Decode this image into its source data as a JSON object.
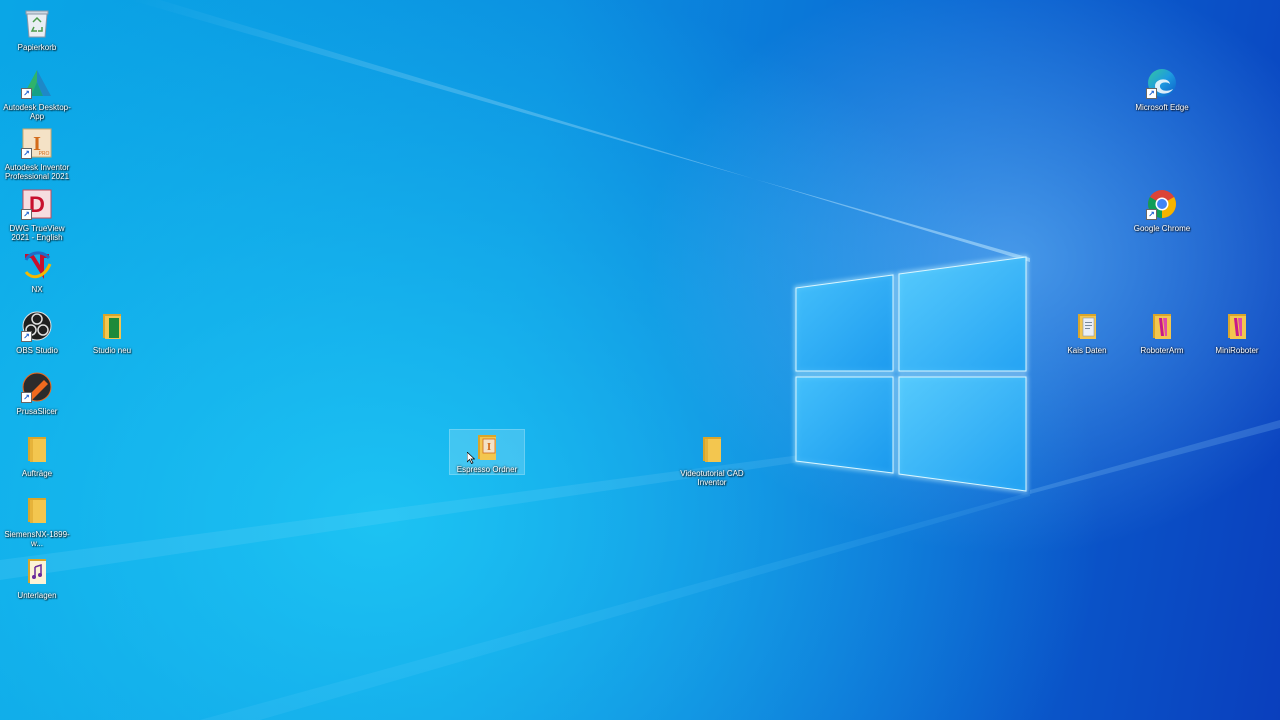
{
  "desktop": {
    "left_icons": [
      {
        "id": "recycle-bin",
        "label": "Papierkorb",
        "icon": "recycle-bin-icon"
      },
      {
        "id": "autodesk-desktop-app",
        "label": "Autodesk Desktop-App",
        "icon": "autodesk-a-icon"
      },
      {
        "id": "autodesk-inventor",
        "label": "Autodesk Inventor Professional 2021",
        "icon": "inventor-icon"
      },
      {
        "id": "dwg-trueview",
        "label": "DWG TrueView 2021 - English",
        "icon": "dwg-d-icon"
      },
      {
        "id": "nx",
        "label": "NX",
        "icon": "nx-icon"
      },
      {
        "id": "obs-studio",
        "label": "OBS Studio",
        "icon": "obs-icon"
      },
      {
        "id": "prusaslicer",
        "label": "PrusaSlicer",
        "icon": "prusa-icon"
      },
      {
        "id": "auftraege",
        "label": "Aufträge",
        "icon": "folder-icon"
      },
      {
        "id": "siemens-nx",
        "label": "SiemensNX-1899-w...",
        "icon": "folder-icon"
      },
      {
        "id": "unterlagen",
        "label": "Unterlagen",
        "icon": "folder-music-icon"
      }
    ],
    "studio_neu": {
      "label": "Studio neu",
      "icon": "folder-green-icon"
    },
    "center_icons": [
      {
        "id": "espresso-ordner",
        "label": "Espresso Ordner",
        "icon": "folder-inventor-icon",
        "selected": true
      },
      {
        "id": "videotutorial",
        "label": "Videotutorial CAD Inventor",
        "icon": "folder-icon",
        "selected": false
      }
    ],
    "right_icons": [
      {
        "id": "microsoft-edge",
        "label": "Microsoft Edge",
        "icon": "edge-icon"
      },
      {
        "id": "google-chrome",
        "label": "Google Chrome",
        "icon": "chrome-icon"
      },
      {
        "id": "kais-daten",
        "label": "Kais Daten",
        "icon": "folder-doc-icon"
      },
      {
        "id": "roboterarm",
        "label": "RoboterArm",
        "icon": "folder-magenta-icon"
      },
      {
        "id": "miniroboter",
        "label": "MiniRoboter",
        "icon": "folder-magenta-icon"
      }
    ],
    "colors": {
      "folder": "#f3c64f",
      "folder_dark": "#d9a52a",
      "wallpaper_light": "#1fc0f0",
      "wallpaper_dark": "#0a3fbd"
    }
  }
}
